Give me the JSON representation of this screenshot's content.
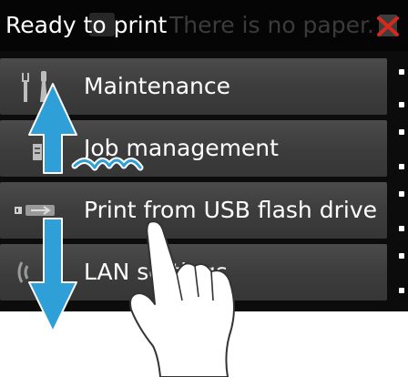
{
  "status_bar": {
    "title": "Ready to print",
    "background_message": "There is no paper.",
    "alert_icon": "no-paper-alert-icon"
  },
  "menu": {
    "items": [
      {
        "label": "Maintenance",
        "icon": "maintenance-tools-icon"
      },
      {
        "label": "Job management",
        "icon": "job-management-icon"
      },
      {
        "label": "Print from USB flash drive",
        "icon": "usb-flash-drive-icon"
      },
      {
        "label": "LAN settings",
        "icon": "lan-settings-icon"
      }
    ]
  },
  "gesture": {
    "icons": [
      "scroll-up-arrow-icon",
      "scroll-down-arrow-icon",
      "tap-gesture-icon",
      "pointing-hand-icon"
    ]
  },
  "colors": {
    "screen_background": "#0c0c0c",
    "menu_item": "#3d3d3d",
    "text": "#ffffff",
    "arrow_blue": "#2f9fd8",
    "alert_red": "#d42a1c"
  }
}
